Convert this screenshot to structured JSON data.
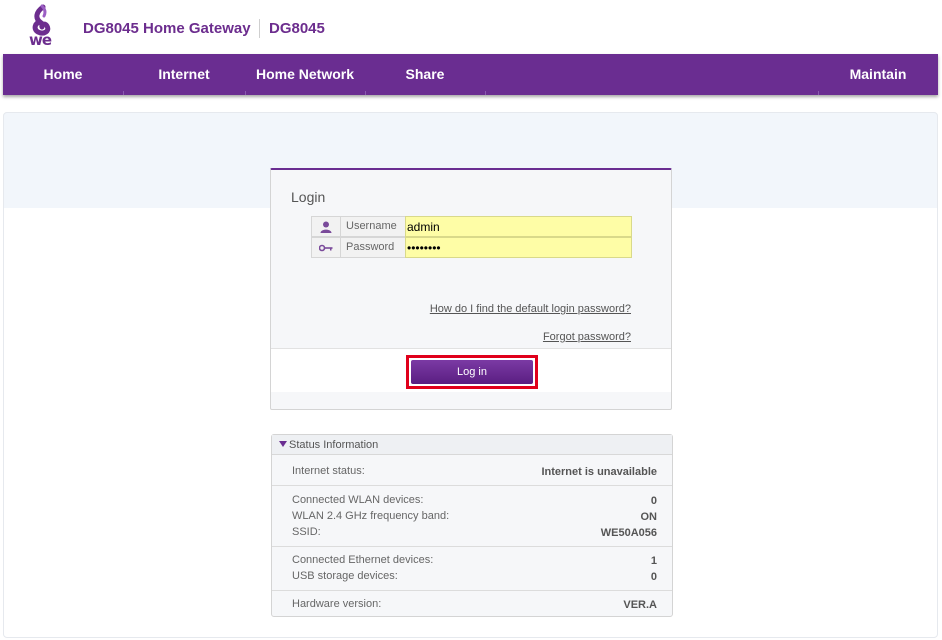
{
  "header": {
    "logo_text": "we",
    "product_title": "DG8045 Home Gateway",
    "model": "DG8045",
    "brand_color": "#6a2d91"
  },
  "nav": {
    "items": [
      "Home",
      "Internet",
      "Home Network",
      "Share",
      "Maintain"
    ]
  },
  "login": {
    "title": "Login",
    "username_label": "Username",
    "username_value": "admin",
    "password_label": "Password",
    "password_value": "password",
    "default_password_link": "How do I find the default login password?",
    "forgot_password_link": "Forgot password?",
    "login_button": "Log in"
  },
  "status": {
    "title": "Status Information",
    "internet_status_label": "Internet status:",
    "internet_status_value": "Internet is unavailable",
    "wlan_devices_label": "Connected WLAN devices:",
    "wlan_devices_value": "0",
    "wlan_band_label": "WLAN 2.4 GHz frequency band:",
    "wlan_band_value": "ON",
    "ssid_label": "SSID:",
    "ssid_value": "WE50A056",
    "ethernet_devices_label": "Connected Ethernet devices:",
    "ethernet_devices_value": "1",
    "usb_devices_label": "USB storage devices:",
    "usb_devices_value": "0",
    "hardware_label": "Hardware version:",
    "hardware_value": "VER.A"
  }
}
